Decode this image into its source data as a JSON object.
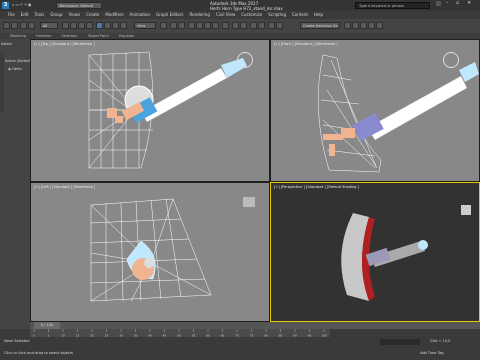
{
  "app": {
    "title": "Autodesk 3ds Max 2017",
    "file_title": "Herts Horn Type H72_stand_mc.max",
    "workspace": "Workspace: Default",
    "search_placeholder": "Type a keyword or phrase"
  },
  "menu": [
    "File",
    "Edit",
    "Tools",
    "Group",
    "Views",
    "Create",
    "Modifiers",
    "Animation",
    "Graph Editors",
    "Rendering",
    "Civil View",
    "Customize",
    "Scripting",
    "Content",
    "Help"
  ],
  "toolbar": {
    "filter_dropdown": "All",
    "view_dropdown": "View",
    "selection_set_dropdown": "Create Selection Se"
  },
  "ribbon": [
    "Modeling",
    "Freeform",
    "Selection",
    "Object Paint",
    "Populate"
  ],
  "left_panel": {
    "select_label": "Select",
    "tree_label": "Scene (Sorted As",
    "item_label": "Herts"
  },
  "viewports": [
    {
      "label": "[+] [Top ] [Standard ] [Wireframe ]"
    },
    {
      "label": "[+] [Front ] [Standard ] [Wireframe ]"
    },
    {
      "label": "[+] [Left ] [Standard ] [Wireframe ]"
    },
    {
      "label": "[+] [Perspective ] [Standard ] [Default Shading ]"
    }
  ],
  "timeline": {
    "frame_readout": "0 / 100",
    "ticks": [
      "0",
      "5",
      "10",
      "15",
      "20",
      "25",
      "30",
      "35",
      "40",
      "45",
      "50",
      "55",
      "60",
      "65",
      "70",
      "75",
      "80",
      "85",
      "90",
      "95",
      "100"
    ],
    "grid_readout": "Grid = 10,0",
    "add_time_tag": "Add Time Tag"
  },
  "status": {
    "none_selected": "None Selected",
    "prompt": "Click or click-and-drag to select objects"
  },
  "colors": {
    "viewport_bg": "#888888",
    "perspective_bg": "#323232",
    "horn_red": "#b02020",
    "wire_white": "#ffffff",
    "accent_blue": "#4aa3df",
    "peach": "#f0b490"
  }
}
